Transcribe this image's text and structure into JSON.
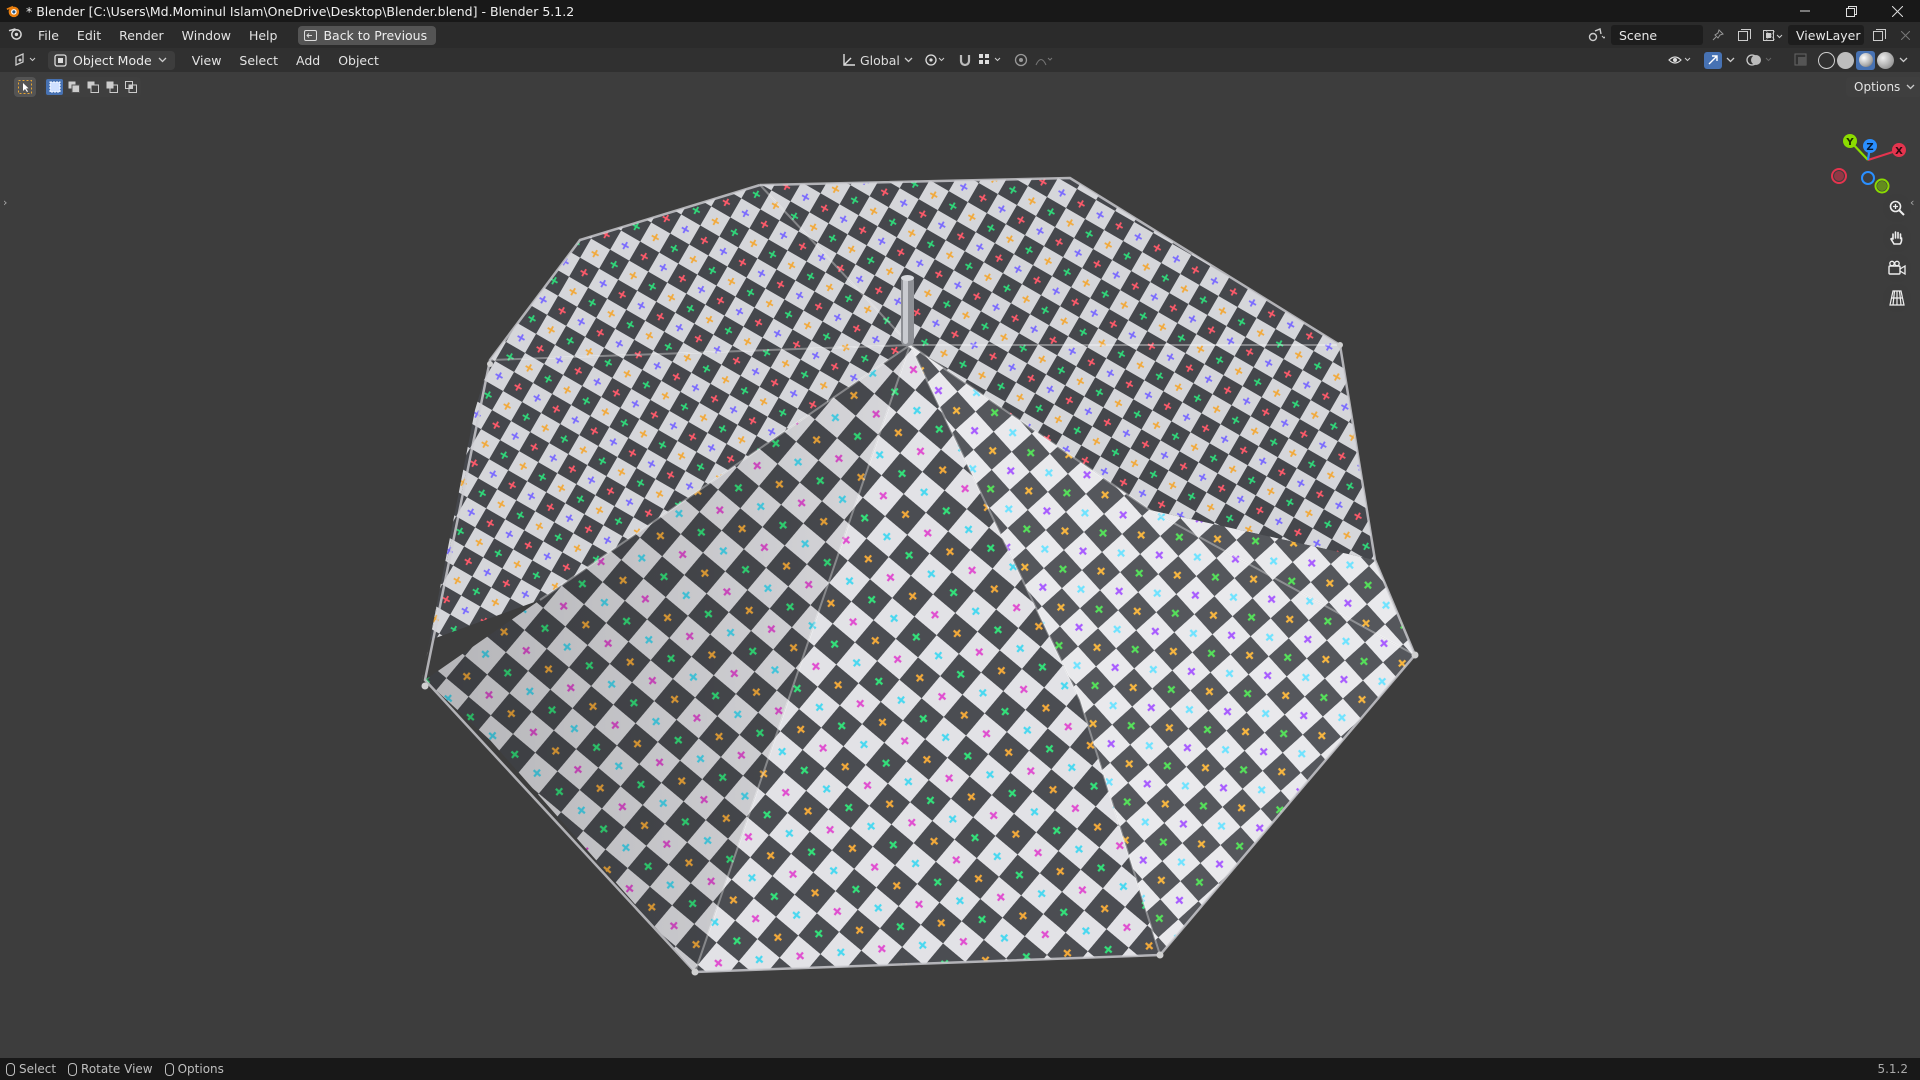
{
  "window": {
    "title": "* Blender [C:\\Users\\Md.Mominul Islam\\OneDrive\\Desktop\\Blender.blend] - Blender 5.1.2",
    "controls": [
      "minimize",
      "restore",
      "close"
    ]
  },
  "menubar": {
    "items": [
      "File",
      "Edit",
      "Render",
      "Window",
      "Help"
    ],
    "back_button": "Back to Previous"
  },
  "scene": {
    "name": "Scene"
  },
  "view_layer": {
    "name": "ViewLayer"
  },
  "viewport_header": {
    "mode": "Object Mode",
    "menus": [
      "View",
      "Select",
      "Add",
      "Object"
    ],
    "transform_orientation": "Global"
  },
  "toolbar": {
    "options_label": "Options"
  },
  "gizmo": {
    "axes": [
      "X",
      "Y",
      "Z"
    ]
  },
  "statusbar": {
    "items": [
      "Select",
      "Rotate View",
      "Options"
    ],
    "version": "5.1.2"
  },
  "colors": {
    "checker_light": "#e2e2e6",
    "checker_dark": "#4b4d52",
    "accent_blue": "#4772b3",
    "gizmo_x": "#e5344e",
    "gizmo_y": "#8bdc00",
    "gizmo_z": "#2a8fff"
  }
}
